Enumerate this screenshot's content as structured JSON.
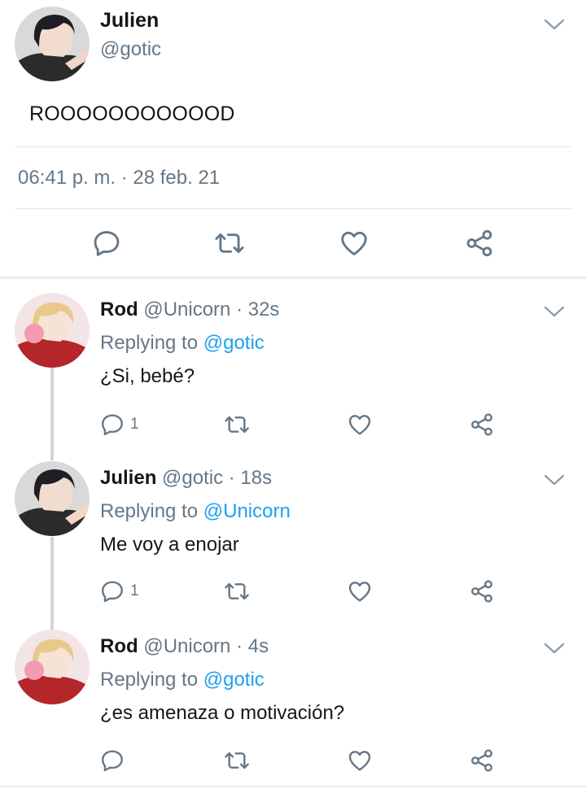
{
  "main_tweet": {
    "author_name": "Julien",
    "author_handle": "@gotic",
    "text": "ROOOOOOOOOOOD",
    "timestamp": "06:41 p. m. · 28 feb. 21",
    "actions": [
      "reply-icon",
      "retweet-icon",
      "like-icon",
      "share-icon"
    ]
  },
  "replies": [
    {
      "author_name": "Rod",
      "author_handle": "@Unicorn",
      "age": "· 32s",
      "replying_label": "Replying to",
      "replying_to": "@gotic",
      "text": "¿Si, bebé?",
      "reply_count": "1"
    },
    {
      "author_name": "Julien",
      "author_handle": "@gotic",
      "age": "· 18s",
      "replying_label": "Replying to",
      "replying_to": "@Unicorn",
      "text": "Me voy a enojar",
      "reply_count": "1"
    },
    {
      "author_name": "Rod",
      "author_handle": "@Unicorn",
      "age": "· 4s",
      "replying_label": "Replying to",
      "replying_to": "@gotic",
      "text": "¿es amenaza o motivación?",
      "reply_count": ""
    }
  ],
  "colors": {
    "text": "#14171a",
    "secondary": "#657786",
    "link": "#1da1f2",
    "divider": "#e1e8ed"
  }
}
